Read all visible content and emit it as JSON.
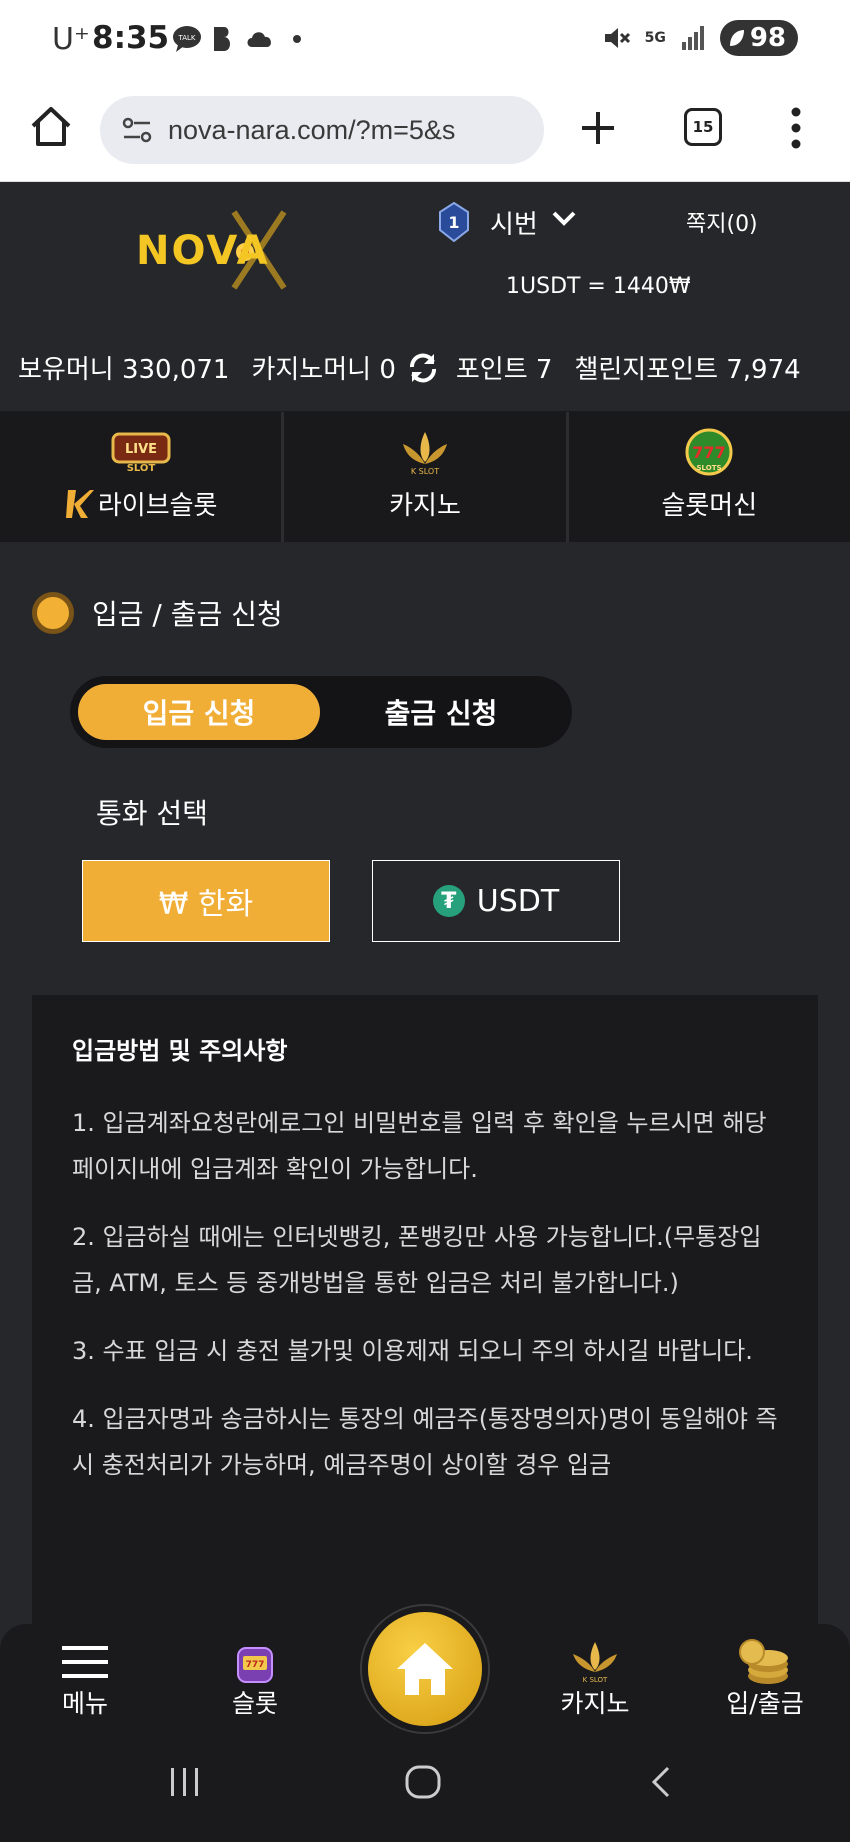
{
  "status_bar": {
    "carrier": "U⁺",
    "time": "8:35",
    "network": "5G",
    "battery": "98"
  },
  "browser": {
    "url": "nova-nara.com/?m=5&s",
    "tab_count": "15"
  },
  "header": {
    "logo_text": "NOVA",
    "level_badge": "1",
    "user_name": "시번",
    "messages": "쪽지(0)",
    "exchange_rate": "1USDT = 1440₩"
  },
  "balances": {
    "holding": "보유머니 330,071",
    "casino": "카지노머니 0",
    "points": "포인트 7",
    "challenge": "챌린지포인트 7,974"
  },
  "game_tabs": [
    {
      "label": "라이브슬롯",
      "icon": "live-slot-icon",
      "prefix": "K"
    },
    {
      "label": "카지노",
      "icon": "k-slot-icon"
    },
    {
      "label": "슬롯머신",
      "icon": "777-slots-icon"
    }
  ],
  "section": {
    "title": "입금 / 출금 신청"
  },
  "toggle": {
    "deposit": "입금 신청",
    "withdraw": "출금 신청"
  },
  "currency": {
    "label": "통화 선택",
    "krw": "₩ 한화",
    "usdt": "USDT"
  },
  "notice": {
    "title": "입금방법 및 주의사항",
    "items": [
      "1. 입금계좌요청란에로그인 비밀번호를 입력 후 확인을 누르시면 해당 페이지내에 입금계좌 확인이 가능합니다.",
      "2. 입금하실 때에는 인터넷뱅킹, 폰뱅킹만 사용 가능합니다.(무통장입금, ATM, 토스 등 중개방법을 통한 입금은 처리 불가합니다.)",
      "3. 수표 입금 시 충전 불가및 이용제재 되오니 주의 하시길 바랍니다.",
      "4. 입금자명과 송금하시는 통장의 예금주(통장명의자)명이 동일해야 즉시 충전처리가 가능하며, 예금주명이 상이할 경우 입금"
    ]
  },
  "bottom_nav": {
    "menu": "메뉴",
    "slot": "슬롯",
    "casino": "카지노",
    "deposit_withdraw": "입/출금"
  },
  "colors": {
    "accent": "#f1ae37",
    "background": "#26272b",
    "panel": "#1a1a1d"
  }
}
